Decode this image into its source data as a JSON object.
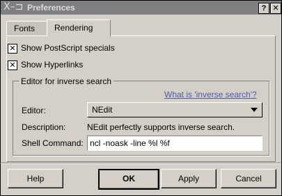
{
  "window": {
    "title": "Preferences",
    "logo": "X–⊐",
    "help_button": "?",
    "close_button": "✕"
  },
  "tabs": [
    {
      "label": "Fonts"
    },
    {
      "label": "Rendering"
    }
  ],
  "rendering": {
    "show_postscript": {
      "label": "Show PostScript specials",
      "checked": true
    },
    "show_hyperlinks": {
      "label": "Show Hyperlinks",
      "checked": true
    },
    "group_title": "Editor for inverse search",
    "help_link": "What is 'inverse search'?",
    "editor_label": "Editor:",
    "editor_value": "NEdit",
    "description_label": "Description:",
    "description_value": "NEdit perfectly supports inverse search.",
    "shell_label": "Shell Command:",
    "shell_value": "ncl -noask -line %l %f"
  },
  "buttons": {
    "help": "Help",
    "ok": "OK",
    "apply": "Apply",
    "cancel": "Cancel"
  },
  "check_mark": "✕"
}
